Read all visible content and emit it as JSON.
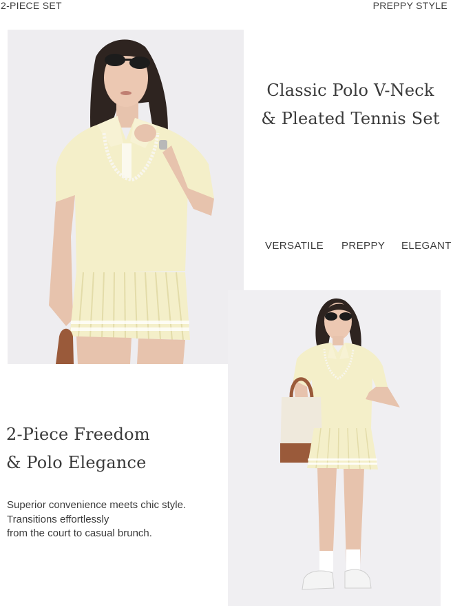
{
  "corner_labels": {
    "left": "2-PIECE SET",
    "right": "PREPPY STYLE"
  },
  "hero": {
    "title_line1": "Classic Polo V-Neck",
    "title_line2": "& Pleated Tennis Set",
    "keywords": [
      "VERSATILE",
      "PREPPY",
      "ELEGANT"
    ]
  },
  "feature": {
    "title_line1": "2-Piece Freedom",
    "title_line2": "& Polo Elegance",
    "body_lines": [
      "Superior convenience meets chic style.",
      "Transitions effortlessly",
      "from the court to casual brunch."
    ]
  },
  "colors": {
    "outfit": "#f4efc9",
    "outfit_shadow": "#e3dca9",
    "skin": "#e7c3ad",
    "hair": "#2e2420",
    "bag_leather": "#9a5a3a",
    "bag_canvas": "#efe9dc",
    "background_photo": "#eeedf0"
  },
  "images": {
    "model_closeup": "model-closeup-photo",
    "model_fullbody": "model-fullbody-photo"
  }
}
